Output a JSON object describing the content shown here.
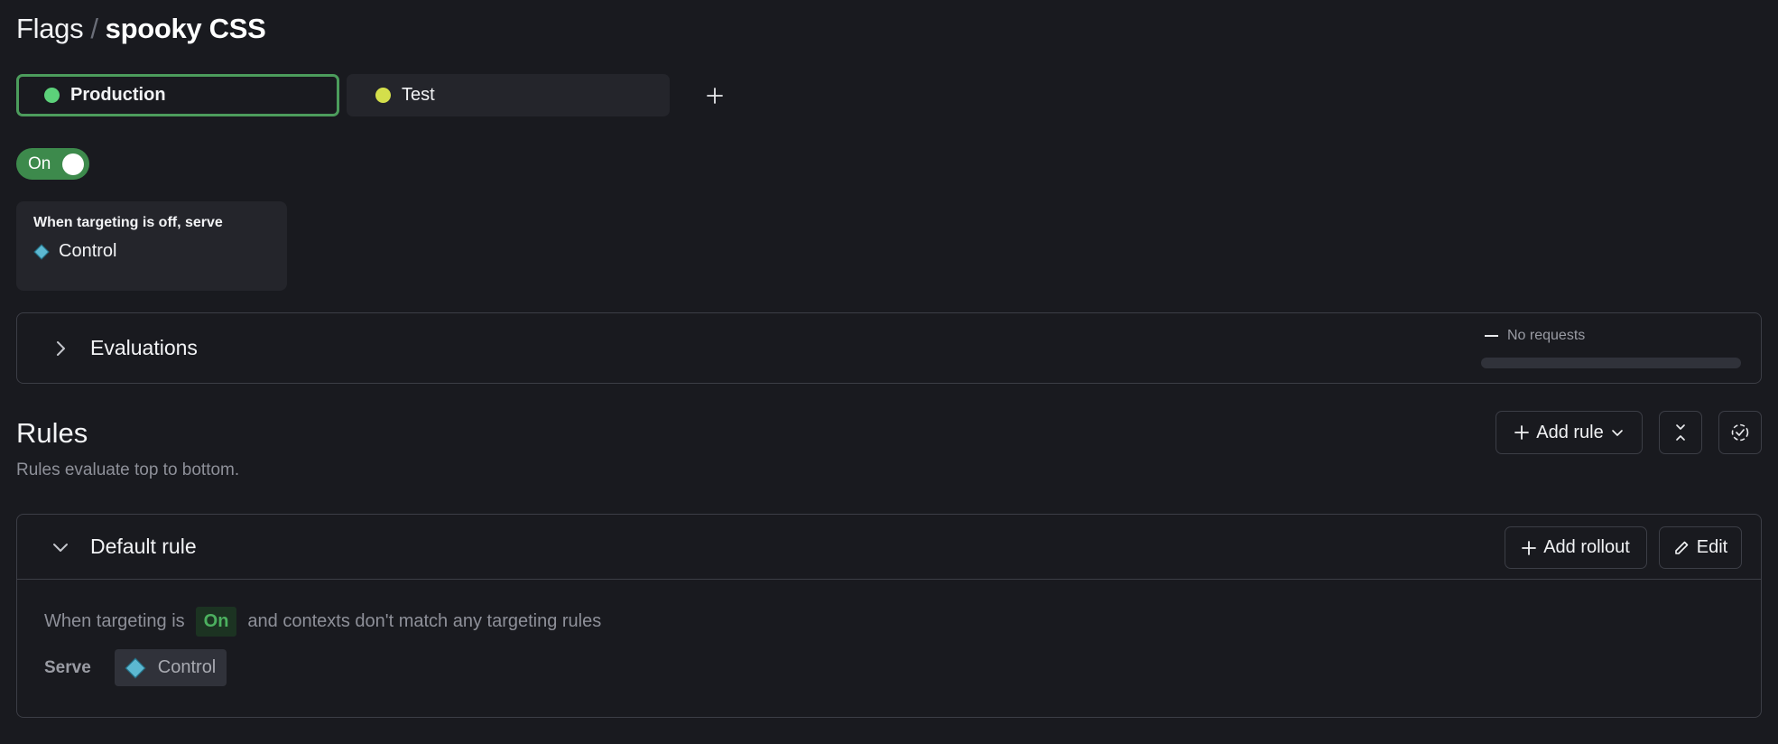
{
  "breadcrumb": {
    "root": "Flags",
    "separator": "/",
    "current": "spooky CSS"
  },
  "environments": {
    "tabs": [
      {
        "label": "Production",
        "active": true,
        "dot_color": "#5cd17a"
      },
      {
        "label": "Test",
        "active": false,
        "dot_color": "#d4df4b"
      }
    ],
    "add_icon": "plus-icon"
  },
  "targeting_toggle": {
    "label": "On",
    "state": true,
    "color": "#3d8a4c"
  },
  "off_variation": {
    "title": "When targeting is off, serve",
    "variation": "Control",
    "variation_icon": "diamond-icon",
    "variation_color": "#5cb8d1"
  },
  "evaluations": {
    "title": "Evaluations",
    "expand_icon": "chevron-right-icon",
    "status": "No requests",
    "progress_percent": 0
  },
  "rules": {
    "title": "Rules",
    "subtitle": "Rules evaluate top to bottom.",
    "add_rule_label": "Add rule",
    "collapse_icon": "collapse-all-icon",
    "check_icon": "dashed-check-circle-icon"
  },
  "default_rule": {
    "title": "Default rule",
    "collapse_icon": "chevron-down-icon",
    "add_rollout_label": "Add rollout",
    "edit_label": "Edit",
    "sentence_prefix": "When targeting is",
    "targeting_state": "On",
    "sentence_suffix": "and contexts don't match any targeting rules",
    "serve_label": "Serve",
    "serve_variation": "Control",
    "accent_on": "#4cb05f"
  }
}
